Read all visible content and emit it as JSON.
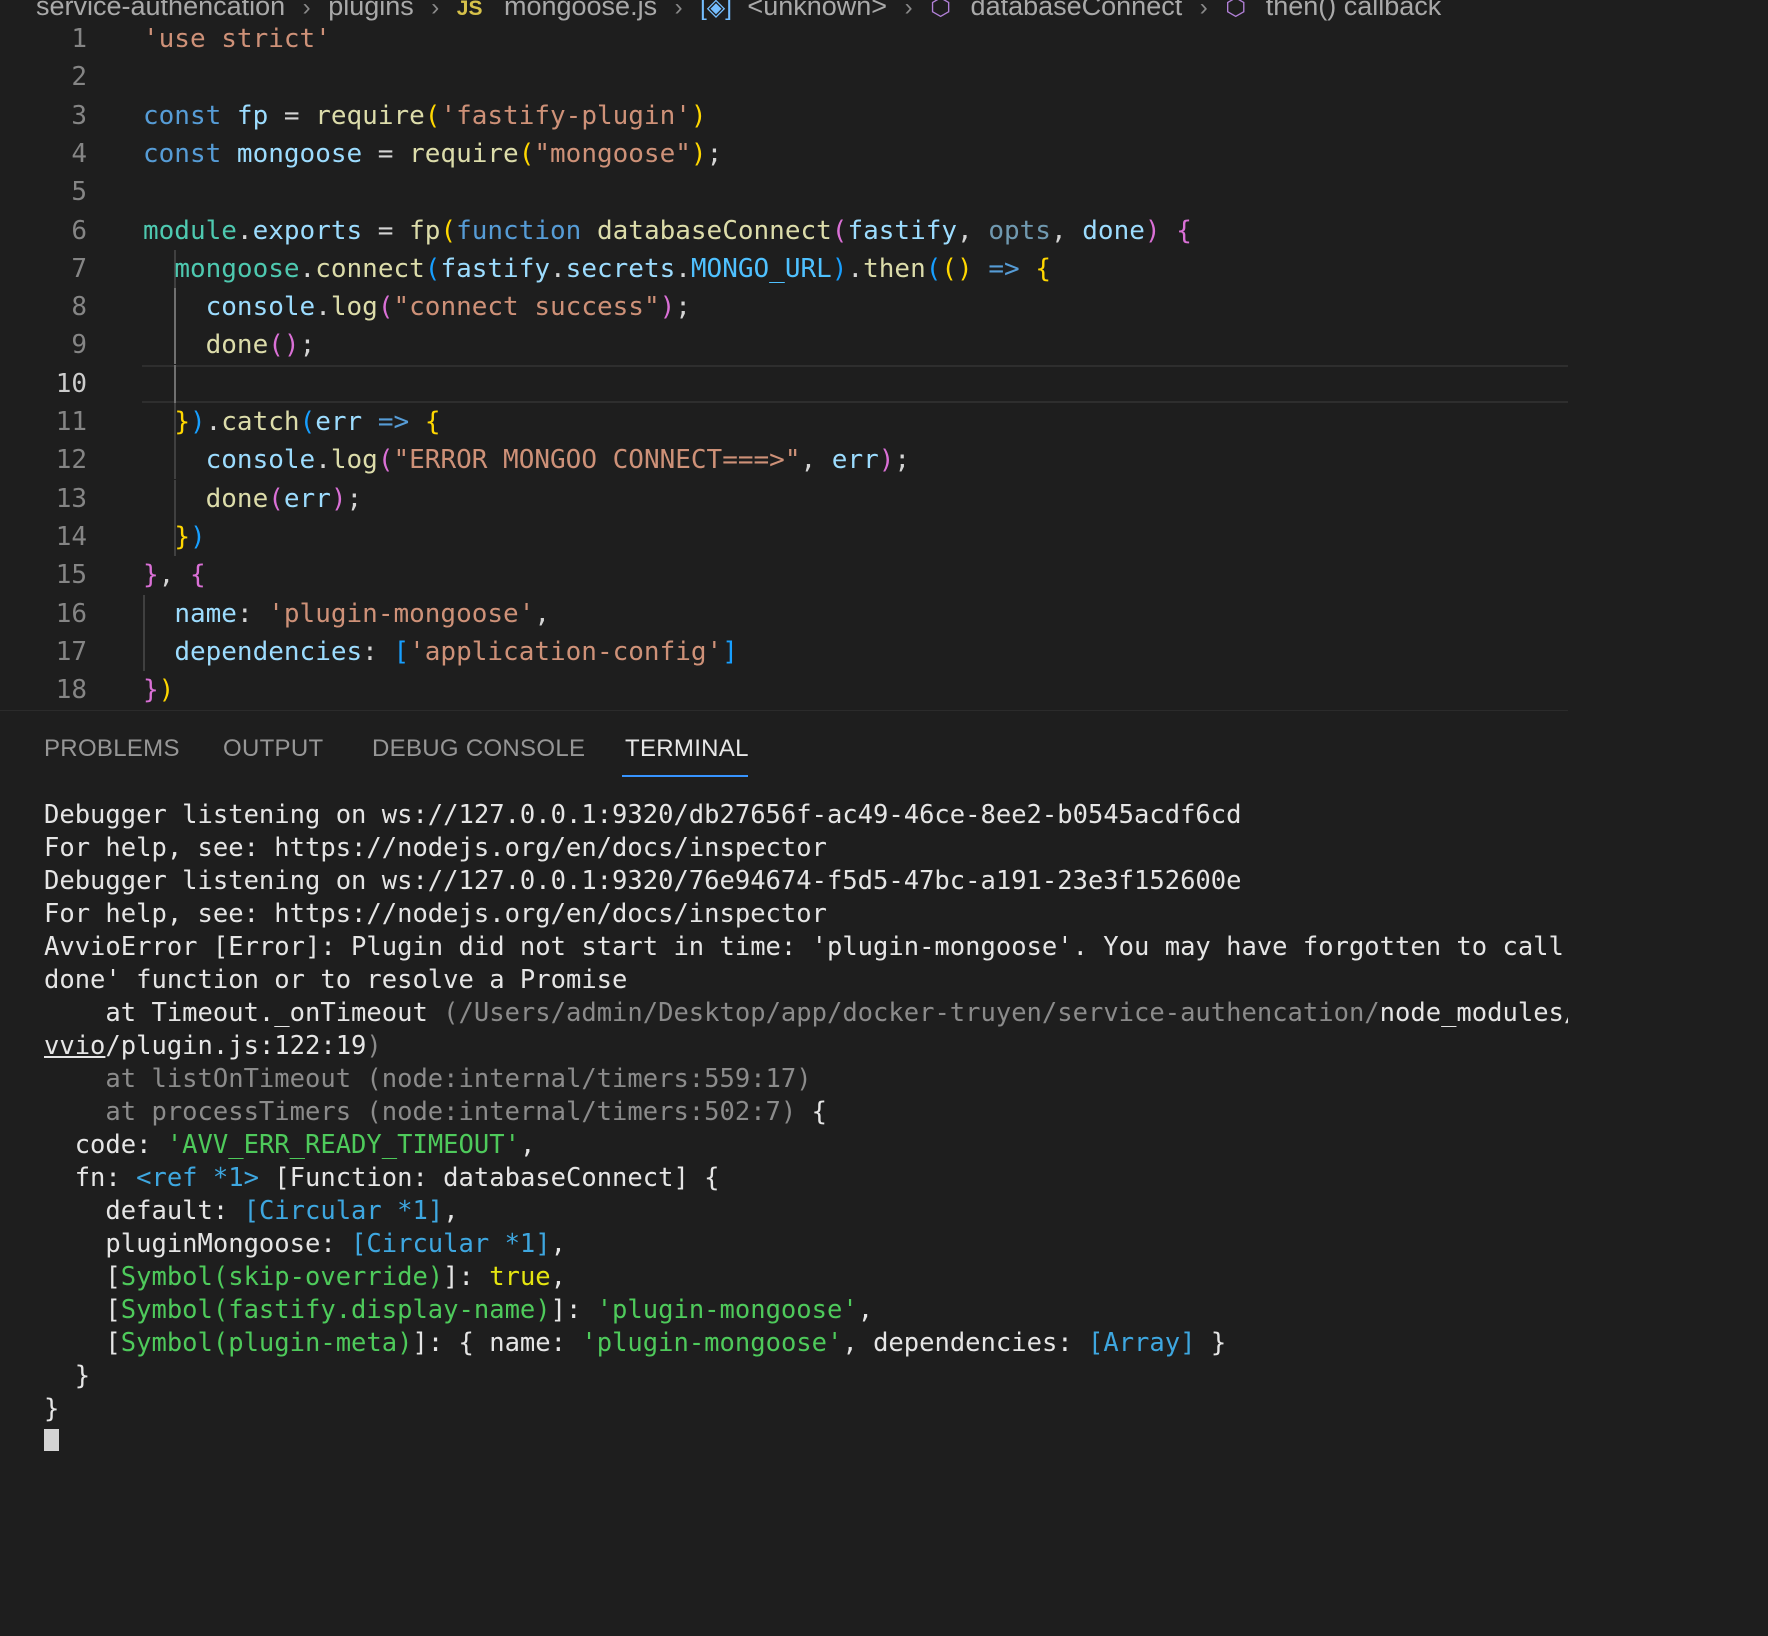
{
  "breadcrumb": {
    "items": [
      "service-authencation",
      "plugins",
      "mongoose.js",
      "<unknown>",
      "databaseConnect",
      "then() callback"
    ],
    "file_badge": "JS"
  },
  "editor": {
    "current_line": 10,
    "lines": [
      {
        "n": "1"
      },
      {
        "n": "2"
      },
      {
        "n": "3"
      },
      {
        "n": "4"
      },
      {
        "n": "5"
      },
      {
        "n": "6"
      },
      {
        "n": "7"
      },
      {
        "n": "8"
      },
      {
        "n": "9"
      },
      {
        "n": "10"
      },
      {
        "n": "11"
      },
      {
        "n": "12"
      },
      {
        "n": "13"
      },
      {
        "n": "14"
      },
      {
        "n": "15"
      },
      {
        "n": "16"
      },
      {
        "n": "17"
      },
      {
        "n": "18"
      }
    ],
    "code": [
      [
        [
          "s",
          "'use strict'"
        ]
      ],
      [],
      [
        [
          "k",
          "const "
        ],
        [
          "v",
          "fp"
        ],
        [
          "op",
          " = "
        ],
        [
          "f",
          "require"
        ],
        [
          "p1",
          "("
        ],
        [
          "s",
          "'fastify-plugin'"
        ],
        [
          "p1",
          ")"
        ]
      ],
      [
        [
          "k",
          "const "
        ],
        [
          "v",
          "mongoose"
        ],
        [
          "op",
          " = "
        ],
        [
          "f",
          "require"
        ],
        [
          "p1",
          "("
        ],
        [
          "s",
          "\"mongoose\""
        ],
        [
          "p1",
          ")"
        ],
        [
          "op",
          ";"
        ]
      ],
      [],
      [
        [
          "t",
          "module"
        ],
        [
          "op",
          "."
        ],
        [
          "v",
          "exports"
        ],
        [
          "op",
          " = "
        ],
        [
          "f",
          "fp"
        ],
        [
          "p1",
          "("
        ],
        [
          "k",
          "function "
        ],
        [
          "f",
          "databaseConnect"
        ],
        [
          "p2",
          "("
        ],
        [
          "v",
          "fastify"
        ],
        [
          "op",
          ", "
        ],
        [
          "param-dim",
          "opts"
        ],
        [
          "op",
          ", "
        ],
        [
          "v",
          "done"
        ],
        [
          "p2",
          ")"
        ],
        [
          "op",
          " "
        ],
        [
          "p2",
          "{"
        ]
      ],
      [
        [
          "op",
          "  "
        ],
        [
          "t",
          "mongoose"
        ],
        [
          "op",
          "."
        ],
        [
          "f",
          "connect"
        ],
        [
          "p3",
          "("
        ],
        [
          "v",
          "fastify"
        ],
        [
          "op",
          "."
        ],
        [
          "v",
          "secrets"
        ],
        [
          "op",
          "."
        ],
        [
          "cn",
          "MONGO_URL"
        ],
        [
          "p3",
          ")"
        ],
        [
          "op",
          "."
        ],
        [
          "f",
          "then"
        ],
        [
          "p3",
          "("
        ],
        [
          "p1",
          "()"
        ],
        [
          "op",
          " "
        ],
        [
          "k",
          "=>"
        ],
        [
          "op",
          " "
        ],
        [
          "p1",
          "{"
        ]
      ],
      [
        [
          "op",
          "    "
        ],
        [
          "v",
          "console"
        ],
        [
          "op",
          "."
        ],
        [
          "f",
          "log"
        ],
        [
          "p2",
          "("
        ],
        [
          "s",
          "\"connect success\""
        ],
        [
          "p2",
          ")"
        ],
        [
          "op",
          ";"
        ]
      ],
      [
        [
          "op",
          "    "
        ],
        [
          "f",
          "done"
        ],
        [
          "p2",
          "()"
        ],
        [
          "op",
          ";"
        ]
      ],
      [],
      [
        [
          "op",
          "  "
        ],
        [
          "p1",
          "}"
        ],
        [
          "p3",
          ")"
        ],
        [
          "op",
          "."
        ],
        [
          "f",
          "catch"
        ],
        [
          "p3",
          "("
        ],
        [
          "v",
          "err"
        ],
        [
          "op",
          " "
        ],
        [
          "k",
          "=>"
        ],
        [
          "op",
          " "
        ],
        [
          "p1",
          "{"
        ]
      ],
      [
        [
          "op",
          "    "
        ],
        [
          "v",
          "console"
        ],
        [
          "op",
          "."
        ],
        [
          "f",
          "log"
        ],
        [
          "p2",
          "("
        ],
        [
          "s",
          "\"ERROR MONGOO CONNECT===>\""
        ],
        [
          "op",
          ", "
        ],
        [
          "v",
          "err"
        ],
        [
          "p2",
          ")"
        ],
        [
          "op",
          ";"
        ]
      ],
      [
        [
          "op",
          "    "
        ],
        [
          "f",
          "done"
        ],
        [
          "p2",
          "("
        ],
        [
          "v",
          "err"
        ],
        [
          "p2",
          ")"
        ],
        [
          "op",
          ";"
        ]
      ],
      [
        [
          "op",
          "  "
        ],
        [
          "p1",
          "}"
        ],
        [
          "p3",
          ")"
        ]
      ],
      [
        [
          "p2",
          "}"
        ],
        [
          "op",
          ", "
        ],
        [
          "p2",
          "{"
        ]
      ],
      [
        [
          "op",
          "  "
        ],
        [
          "v",
          "name"
        ],
        [
          "op",
          ": "
        ],
        [
          "s",
          "'plugin-mongoose'"
        ],
        [
          "op",
          ","
        ]
      ],
      [
        [
          "op",
          "  "
        ],
        [
          "v",
          "dependencies"
        ],
        [
          "op",
          ": "
        ],
        [
          "p3",
          "["
        ],
        [
          "s",
          "'application-config'"
        ],
        [
          "p3",
          "]"
        ]
      ],
      [
        [
          "p2",
          "}"
        ],
        [
          "p1",
          ")"
        ]
      ]
    ]
  },
  "panel": {
    "tabs": [
      {
        "label": "PROBLEMS",
        "active": false
      },
      {
        "label": "OUTPUT",
        "active": false
      },
      {
        "label": "DEBUG CONSOLE",
        "active": false
      },
      {
        "label": "TERMINAL",
        "active": true
      }
    ]
  },
  "terminal": {
    "lines": [
      [
        [
          "",
          "Debugger listening on ws://127.0.0.1:9320/db27656f-ac49-46ce-8ee2-b0545acdf6cd"
        ]
      ],
      [
        [
          "",
          "For help, see: https://nodejs.org/en/docs/inspector"
        ]
      ],
      [
        [
          "",
          "Debugger listening on ws://127.0.0.1:9320/76e94674-f5d5-47bc-a191-23e3f152600e"
        ]
      ],
      [
        [
          "",
          "For help, see: https://nodejs.org/en/docs/inspector"
        ]
      ],
      [
        [
          "",
          "AvvioError [Error]: Plugin did not start in time: 'plugin-mongoose'. You may have forgotten to call '"
        ]
      ],
      [
        [
          "",
          "done' function or to resolve a Promise"
        ]
      ],
      [
        [
          "",
          "    at Timeout._onTimeout "
        ],
        [
          "dim",
          "(/Users/admin/Desktop/app/docker-truyen/service-authencation/"
        ],
        [
          "",
          "node_modules/"
        ],
        [
          "ul",
          "a"
        ]
      ],
      [
        [
          "ul",
          "vvio"
        ],
        [
          "",
          "/plugin.js:122:19"
        ],
        [
          "dim",
          ")"
        ]
      ],
      [
        [
          "dim",
          "    at listOnTimeout (node:internal/timers:559:17)"
        ]
      ],
      [
        [
          "dim",
          "    at processTimers (node:internal/timers:502:7)"
        ],
        [
          "",
          " {"
        ]
      ],
      [
        [
          "",
          "  code: "
        ],
        [
          "green",
          "'AVV_ERR_READY_TIMEOUT'"
        ],
        [
          "",
          ","
        ]
      ],
      [
        [
          "",
          "  fn: "
        ],
        [
          "tblue",
          "<ref *1>"
        ],
        [
          "",
          " [Function: databaseConnect] {"
        ]
      ],
      [
        [
          "",
          "    default: "
        ],
        [
          "tblue",
          "[Circular *1]"
        ],
        [
          "",
          ","
        ]
      ],
      [
        [
          "",
          "    pluginMongoose: "
        ],
        [
          "tblue",
          "[Circular *1]"
        ],
        [
          "",
          ","
        ]
      ],
      [
        [
          "",
          "    ["
        ],
        [
          "green",
          "Symbol(skip-override)"
        ],
        [
          "",
          "]: "
        ],
        [
          "yellow",
          "true"
        ],
        [
          "",
          ","
        ]
      ],
      [
        [
          "",
          "    ["
        ],
        [
          "green",
          "Symbol(fastify.display-name)"
        ],
        [
          "",
          "]: "
        ],
        [
          "green",
          "'plugin-mongoose'"
        ],
        [
          "",
          ","
        ]
      ],
      [
        [
          "",
          "    ["
        ],
        [
          "green",
          "Symbol(plugin-meta)"
        ],
        [
          "",
          "]: { name: "
        ],
        [
          "green",
          "'plugin-mongoose'"
        ],
        [
          "",
          ", dependencies: "
        ],
        [
          "tblue",
          "[Array]"
        ],
        [
          "",
          " }"
        ]
      ],
      [
        [
          "",
          "  }"
        ]
      ],
      [
        [
          "",
          "}"
        ]
      ]
    ]
  }
}
